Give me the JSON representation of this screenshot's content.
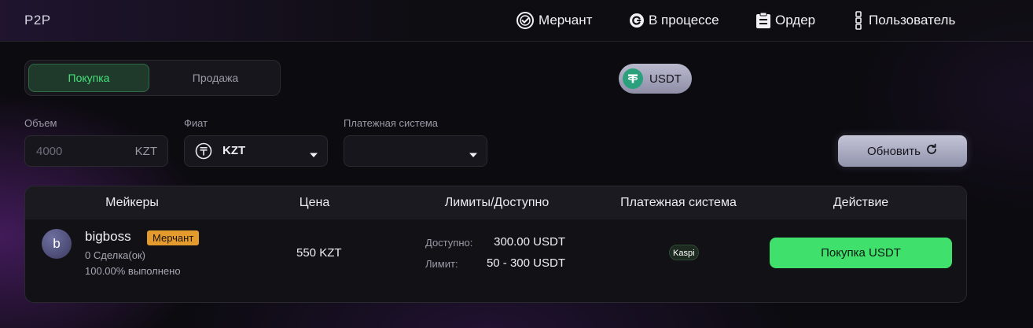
{
  "header": {
    "brand": "P2P",
    "nav": [
      {
        "label": "Мерчант",
        "icon": "merchant-badge-icon"
      },
      {
        "label": "В процессе",
        "icon": "in-progress-icon"
      },
      {
        "label": "Ордер",
        "icon": "order-icon"
      },
      {
        "label": "Пользователь",
        "icon": "user-icon"
      }
    ]
  },
  "trade_toggle": {
    "buy_label": "Покупка",
    "sell_label": "Продажа",
    "active": "buy"
  },
  "coin": {
    "label": "USDT",
    "icon": "tether-icon",
    "color": "#2aa17c"
  },
  "filters": {
    "amount": {
      "label": "Объем",
      "placeholder": "4000",
      "unit": "KZT"
    },
    "fiat": {
      "label": "Фиат",
      "value": "KZT",
      "icon": "tenge-icon"
    },
    "payment": {
      "label": "Платежная система",
      "value": ""
    },
    "refresh_label": "Обновить"
  },
  "table": {
    "headers": {
      "makers": "Мейкеры",
      "price": "Цена",
      "limits": "Лимиты/Доступно",
      "payment": "Платежная система",
      "action": "Действие"
    },
    "rows": [
      {
        "avatar_letter": "b",
        "name": "bigboss",
        "badge": "Мерчант",
        "deals": "0 Сделка(ок)",
        "completion": "100.00% выполнено",
        "price": "550 KZT",
        "available_label": "Доступно:",
        "available_value": "300.00 USDT",
        "limit_label": "Лимит:",
        "limit_value": "50 - 300 USDT",
        "payment": "Kaspi",
        "action_label": "Покупка USDT"
      }
    ]
  },
  "colors": {
    "accent_green": "#3fe06b",
    "badge_orange": "#e39b2e",
    "background": "#0c0b10"
  }
}
